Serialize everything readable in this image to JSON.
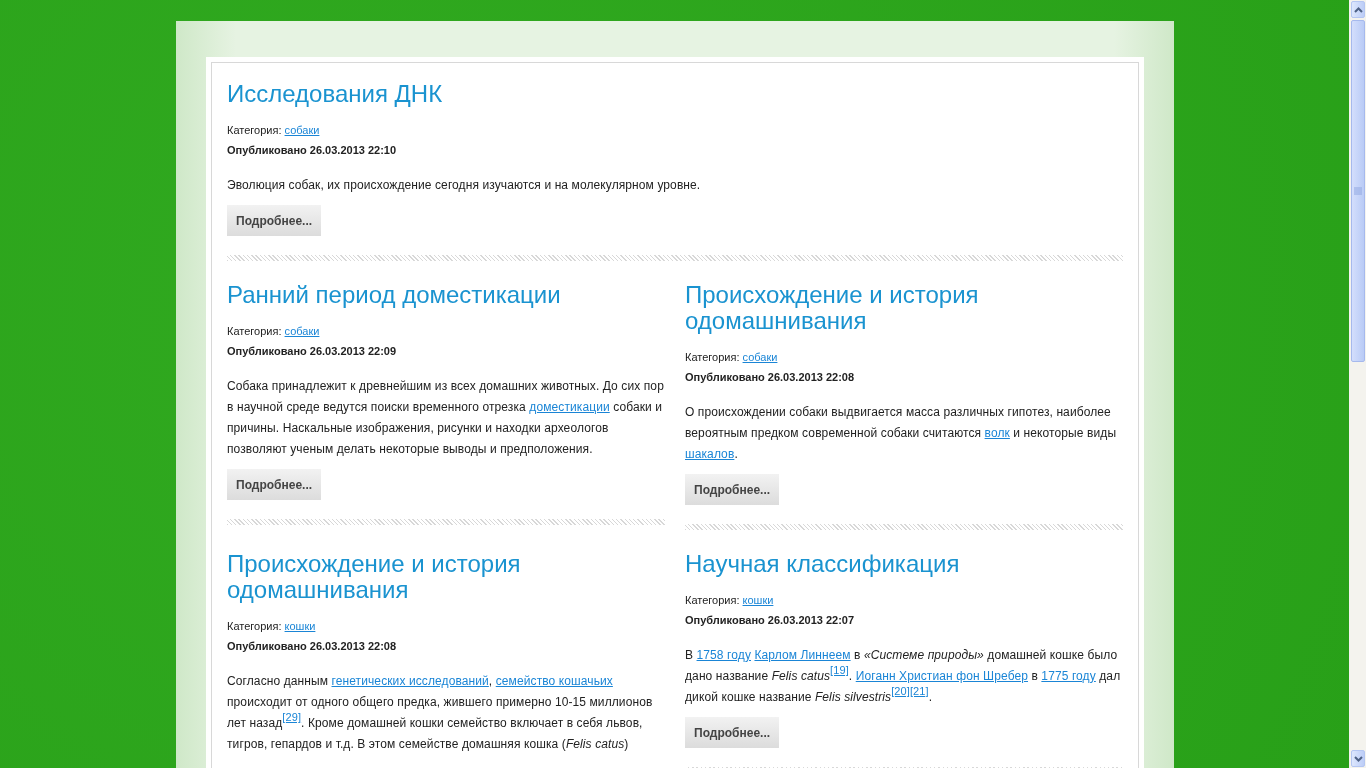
{
  "articles": [
    {
      "title": "Исследования ДНК",
      "category_label": "Категория:",
      "category": "собаки",
      "published": "Опубликовано 26.03.2013 22:10",
      "body": [
        {
          "kind": "text",
          "text": "Эволюция собак, их происхождение сегодня изучаются и на молекулярном уровне."
        }
      ],
      "button": "Подробнее..."
    },
    {
      "title": "Ранний период доместикации",
      "category_label": "Категория:",
      "category": "собаки",
      "published": "Опубликовано 26.03.2013 22:09",
      "body": [
        {
          "kind": "text",
          "text": "Собака принадлежит к древнейшим из всех домашних животных. До сих пор в научной среде ведутся поиски временного отрезка "
        },
        {
          "kind": "link",
          "text": "доместикации"
        },
        {
          "kind": "text",
          "text": " собаки и причины. Наскальные изображения, рисунки и находки археологов позволяют ученым делать некоторые выводы и предположения."
        }
      ],
      "button": "Подробнее..."
    },
    {
      "title": "Происхождение и история одомашнивания",
      "category_label": "Категория:",
      "category": "собаки",
      "published": "Опубликовано 26.03.2013 22:08",
      "body": [
        {
          "kind": "text",
          "text": "О происхождении собаки выдвигается масса различных гипотез, наиболее вероятным предком современной собаки считаются "
        },
        {
          "kind": "link",
          "text": "волк"
        },
        {
          "kind": "text",
          "text": " и некоторые виды "
        },
        {
          "kind": "link",
          "text": "шакалов"
        },
        {
          "kind": "text",
          "text": "."
        }
      ],
      "button": "Подробнее..."
    },
    {
      "title": "Происхождение и история одомашнивания",
      "category_label": "Категория:",
      "category": "кошки",
      "published": "Опубликовано 26.03.2013 22:08",
      "body": [
        {
          "kind": "text",
          "text": "Согласно данным "
        },
        {
          "kind": "link",
          "text": "генетических исследований"
        },
        {
          "kind": "text",
          "text": ", "
        },
        {
          "kind": "link",
          "text": "семейство кошачьих"
        },
        {
          "kind": "text",
          "text": " происходит от одного общего предка, жившего примерно 10-15 миллионов лет назад"
        },
        {
          "kind": "ref",
          "text": "[29]"
        },
        {
          "kind": "text",
          "text": ". Кроме домашней кошки семейство включает в себя львов, тигров, гепардов и т.д. В этом семействе домашняя кошка ("
        },
        {
          "kind": "italic",
          "text": "Felis catus"
        },
        {
          "kind": "text",
          "text": ")"
        }
      ]
    },
    {
      "title": "Научная классификация",
      "category_label": "Категория:",
      "category": "кошки",
      "published": "Опубликовано 26.03.2013 22:07",
      "body": [
        {
          "kind": "text",
          "text": "В "
        },
        {
          "kind": "link",
          "text": "1758 году"
        },
        {
          "kind": "link",
          "text": "Карлом Линнеем"
        },
        {
          "kind": "text",
          "text": " в "
        },
        {
          "kind": "italic",
          "text": "«Системе природы»"
        },
        {
          "kind": "text",
          "text": " домашней кошке было дано название "
        },
        {
          "kind": "italic",
          "text": "Felis catus"
        },
        {
          "kind": "ref",
          "text": "[19]"
        },
        {
          "kind": "text",
          "text": ". "
        },
        {
          "kind": "link",
          "text": "Иоганн Христиан фон Шребер"
        },
        {
          "kind": "text",
          "text": " в "
        },
        {
          "kind": "link",
          "text": "1775 году"
        },
        {
          "kind": "text",
          "text": " дал дикой кошке название "
        },
        {
          "kind": "italic",
          "text": "Felis silvestris"
        },
        {
          "kind": "ref",
          "text": "[20]"
        },
        {
          "kind": "ref",
          "text": "[21]"
        },
        {
          "kind": "text",
          "text": "."
        }
      ],
      "button": "Подробнее..."
    }
  ]
}
